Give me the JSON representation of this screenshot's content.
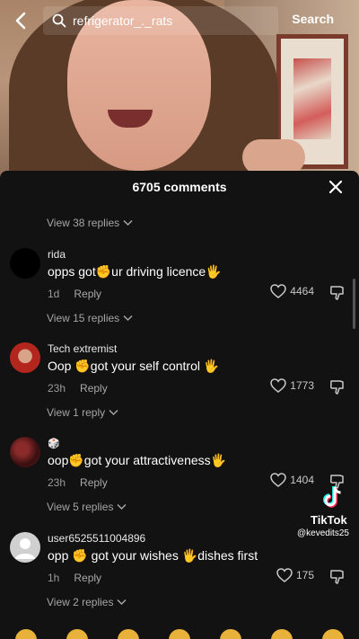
{
  "search": {
    "query": "refrigerator_._rats",
    "button_label": "Search"
  },
  "sheet": {
    "title": "6705 comments"
  },
  "first_replies": {
    "label": "View 38 replies"
  },
  "comments": [
    {
      "username": "rida",
      "text_a": "opps got",
      "emoji_a": "✊",
      "text_b": "ur driving licence",
      "emoji_b": "🖐",
      "text_c": "",
      "time": "1d",
      "reply_label": "Reply",
      "likes": "4464",
      "replies_label": "View 15 replies",
      "avatar_color": "#000000"
    },
    {
      "username": "Tech extremist",
      "text_a": "Oop ",
      "emoji_a": "✊",
      "text_b": "got your self control ",
      "emoji_b": "🖐",
      "text_c": "",
      "time": "23h",
      "reply_label": "Reply",
      "likes": "1773",
      "replies_label": "View 1 reply",
      "avatar_color": "#b3261e"
    },
    {
      "username": "",
      "text_a": "oop",
      "emoji_a": "✊",
      "text_b": "got your attractiveness",
      "emoji_b": "🖐",
      "text_c": "",
      "time": "23h",
      "reply_label": "Reply",
      "likes": "1404",
      "replies_label": "View 5 replies",
      "avatar_color": "#5a1a1a"
    },
    {
      "username": "user6525511004896",
      "text_a": "opp ",
      "emoji_a": "✊",
      "text_b": " got your wishes ",
      "emoji_b": "🖐",
      "text_c": "dishes first",
      "time": "1h",
      "reply_label": "Reply",
      "likes": "175",
      "replies_label": "View 2 replies",
      "avatar_color": "#d0d0d0"
    }
  ],
  "watermark": {
    "brand": "TikTok",
    "handle": "@kevedits25"
  },
  "colors": {
    "sheet_bg": "#121212",
    "muted_text": "#a5a5a5",
    "tiktok_cyan": "#25f4ee",
    "tiktok_red": "#fe2c55"
  },
  "icons": {
    "back": "chevron-left-icon",
    "search": "search-icon",
    "close": "close-icon",
    "like": "heart-outline-icon",
    "dislike": "thumbs-down-icon",
    "expand": "chevron-down-icon"
  }
}
